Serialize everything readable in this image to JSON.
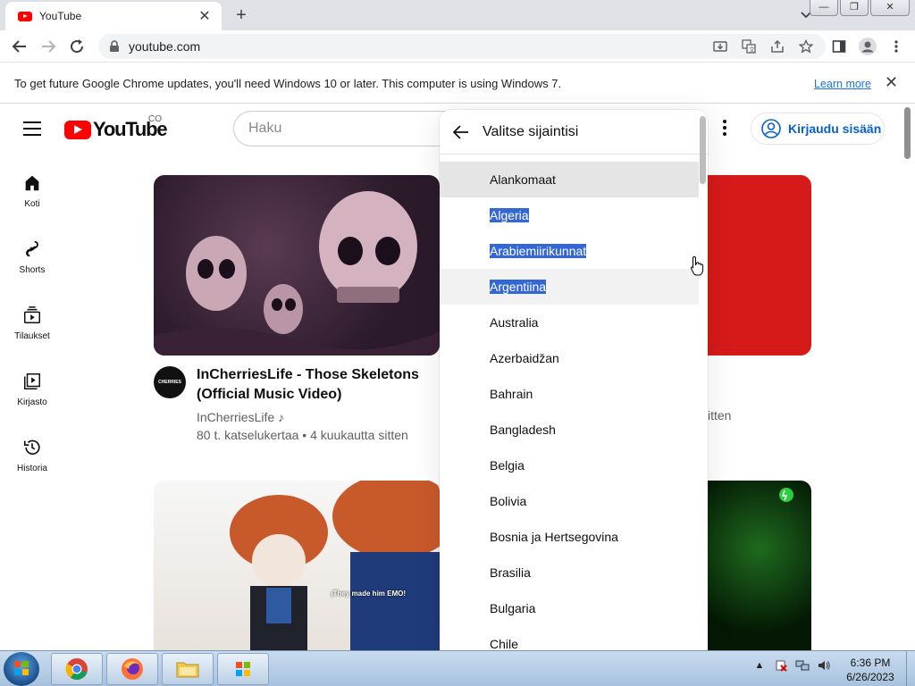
{
  "browser": {
    "tab_title": "YouTube",
    "url": "youtube.com",
    "infobar_message": "To get future Google Chrome updates, you'll need Windows 10 or later. This computer is using Windows 7.",
    "infobar_link": "Learn more"
  },
  "youtube": {
    "logo_text": "YouTube",
    "country_code": "CO",
    "search_placeholder": "Haku",
    "sign_in_label": "Kirjaudu sisään",
    "guide": [
      {
        "label": "Koti",
        "icon": "home-icon"
      },
      {
        "label": "Shorts",
        "icon": "shorts-icon"
      },
      {
        "label": "Tilaukset",
        "icon": "subscriptions-icon"
      },
      {
        "label": "Kirjasto",
        "icon": "library-icon"
      },
      {
        "label": "Historia",
        "icon": "history-icon"
      }
    ],
    "video1": {
      "title": "InCherriesLife - Those Skeletons (Official Music Video)",
      "channel": "InCherriesLife",
      "meta": "80 t. katselukertaa • 4 kuukautta sitten",
      "avatar_text": "CHERRIES"
    },
    "video2_meta_fragment": "itten",
    "thumb3_overlay": "¡They made him EMO!"
  },
  "location_menu": {
    "title": "Valitse sijaintisi",
    "items": [
      "Alankomaat",
      "Algeria",
      "Arabiemiirikunnat",
      "Argentiina",
      "Australia",
      "Azerbaidžan",
      "Bahrain",
      "Bangladesh",
      "Belgia",
      "Bolivia",
      "Bosnia ja Hertsegovina",
      "Brasilia",
      "Bulgaria",
      "Chile"
    ]
  },
  "taskbar": {
    "time": "6:36 PM",
    "date": "6/26/2023"
  },
  "colors": {
    "youtube_red": "#ff0000",
    "link_blue": "#065fd4",
    "selection_blue": "#3367d6"
  }
}
